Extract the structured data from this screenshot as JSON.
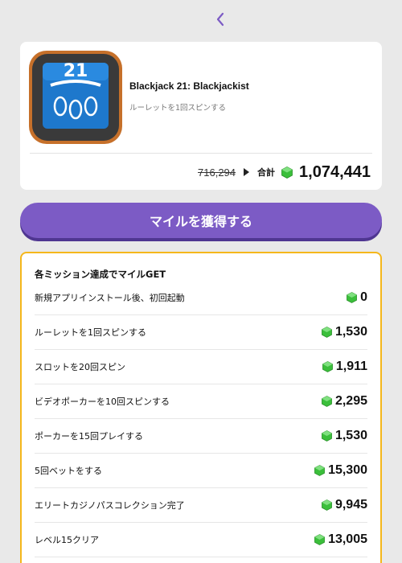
{
  "nav": {
    "back_icon": "chevron-left-icon",
    "accent": "#7c5bc5"
  },
  "app": {
    "icon": "blackjack-21-table-icon",
    "icon_text": "21",
    "title": "Blackjack 21: Blackjackist",
    "subtitle": "ルーレットを1回スピンする"
  },
  "points": {
    "old_total": "716,294",
    "total_label": "合計",
    "total_value": "1,074,441",
    "gem_icon": "green-gem-icon",
    "gem_color": "#3bbf3b"
  },
  "cta": {
    "label": "マイルを獲得する",
    "color": "#7c5bc5"
  },
  "missions": {
    "heading": "各ミッション達成でマイルGET",
    "border_color": "#f5b71c",
    "items": [
      {
        "label": "新規アプリインストール後、初回起動",
        "value": "0"
      },
      {
        "label": "ルーレットを1回スピンする",
        "value": "1,530"
      },
      {
        "label": "スロットを20回スピン",
        "value": "1,911"
      },
      {
        "label": "ビデオポーカーを10回スピンする",
        "value": "2,295"
      },
      {
        "label": "ポーカーを15回プレイする",
        "value": "1,530"
      },
      {
        "label": "5回ベットをする",
        "value": "15,300"
      },
      {
        "label": "エリートカジノパスコレクション完了",
        "value": "9,945"
      },
      {
        "label": "レベル15クリア",
        "value": "13,005"
      }
    ]
  }
}
